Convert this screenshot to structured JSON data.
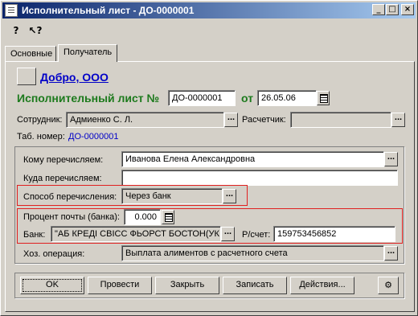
{
  "window": {
    "title": "Исполнительный лист - ДО-0000001",
    "controls": {
      "minimize": "_",
      "maximize": "□",
      "close": "×"
    }
  },
  "toolbar": {
    "help_icon": "?",
    "whatsthis_icon": "↖?"
  },
  "tabs": [
    {
      "label": "Основные",
      "active": false
    },
    {
      "label": "Получатель",
      "active": true
    }
  ],
  "org": {
    "button_label": "...",
    "name": "Добро, ООО"
  },
  "document": {
    "title": "Исполнительный лист №",
    "number": "ДО-0000001",
    "date_label": "от",
    "date": "26.05.06"
  },
  "employee": {
    "label": "Сотрудник:",
    "value": "Адмиенко С. Л."
  },
  "calculator": {
    "label": "Расчетчик:",
    "value": ""
  },
  "tab_number": {
    "label": "Таб. номер:",
    "value": "ДО-0000001"
  },
  "recipient": {
    "to_whom_label": "Кому перечисляем:",
    "to_whom_value": "Иванова Елена Александровна",
    "where_label": "Куда перечисляем:",
    "where_value": "",
    "method_label": "Способ перечисления:",
    "method_value": "Через банк",
    "postal_percent_label": "Процент почты (банка):",
    "postal_percent_value": "0.000",
    "bank_label": "Банк:",
    "bank_value": "\"АБ КРЕДІ СВІСС ФЬОРСТ БОСТОН(УК",
    "account_label": "Р/счет:",
    "account_value": "159753456852",
    "operation_label": "Хоз. операция:",
    "operation_value": "Выплата алиментов с расчетного счета"
  },
  "buttons": {
    "ok": "OK",
    "post": "Провести",
    "close": "Закрыть",
    "save": "Записать",
    "actions": "Действия..."
  },
  "dots": "..."
}
